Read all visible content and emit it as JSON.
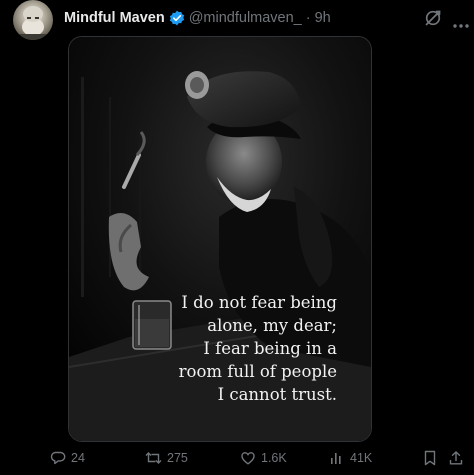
{
  "post": {
    "author": {
      "display_name": "Mindful Maven",
      "handle": "@mindfulmaven_",
      "separator": "·",
      "time": "9h",
      "verified": true
    },
    "media": {
      "quote_lines": [
        "I do not fear being",
        "alone, my dear;",
        "I fear being in a",
        "room full of people",
        "I cannot trust."
      ]
    },
    "actions": {
      "replies": "24",
      "reposts": "275",
      "likes": "1.6K",
      "views": "41K"
    }
  },
  "colors": {
    "background": "#000000",
    "text_primary": "#e7e9ea",
    "text_secondary": "#71767b",
    "verified_blue": "#1d9bf0",
    "border": "#2f3336"
  },
  "icons": {
    "verified": "verified-badge-icon",
    "grok": "grok-icon",
    "more": "more-icon",
    "reply": "reply-icon",
    "repost": "repost-icon",
    "like": "like-icon",
    "views": "views-icon",
    "bookmark": "bookmark-icon",
    "share": "share-icon"
  }
}
